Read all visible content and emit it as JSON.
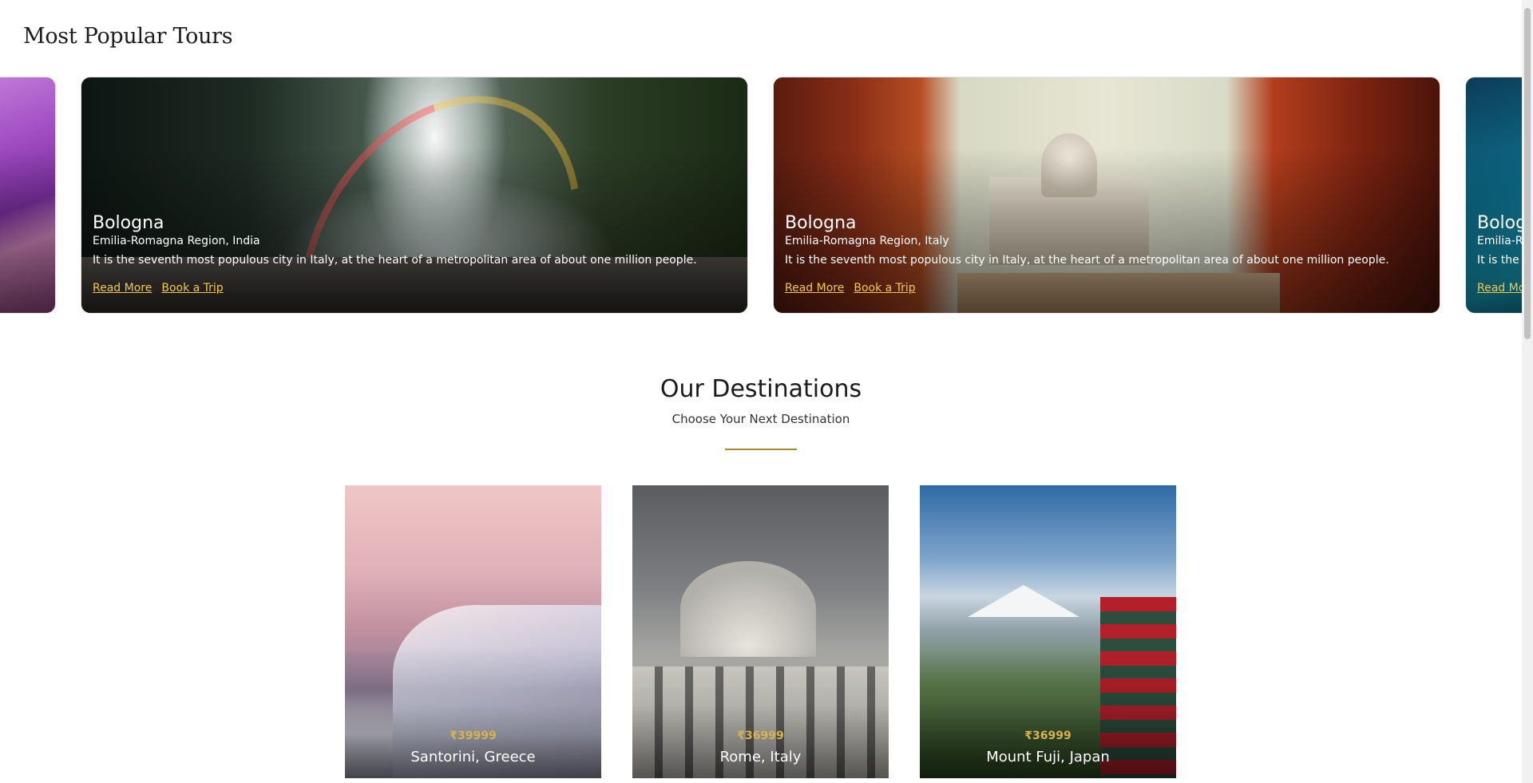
{
  "popular": {
    "title": "Most Popular Tours",
    "cards": [
      {
        "title": "",
        "region": "",
        "desc": "",
        "read_more": "",
        "book": ""
      },
      {
        "title": "Bologna",
        "region": "Emilia-Romagna Region, India",
        "desc": "It is the seventh most populous city in Italy, at the heart of a metropolitan area of about one million people.",
        "read_more": "Read More",
        "book": "Book a Trip"
      },
      {
        "title": "Bologna",
        "region": "Emilia-Romagna Region, Italy",
        "desc": "It is the seventh most populous city in Italy, at the heart of a metropolitan area of about one million people.",
        "read_more": "Read More",
        "book": "Book a Trip"
      },
      {
        "title": "Bolog",
        "region": "Emilia-R",
        "desc": "It is the",
        "read_more": "Read Mo",
        "book": ""
      }
    ]
  },
  "destinations": {
    "title": "Our Destinations",
    "subtitle": "Choose Your Next Destination",
    "items": [
      {
        "price": "₹39999",
        "name": "Santorini, Greece"
      },
      {
        "price": "₹36999",
        "name": "Rome, Italy"
      },
      {
        "price": "₹36999",
        "name": "Mount Fuji, Japan"
      }
    ]
  },
  "colors": {
    "accent": "#a78a2a",
    "link": "#f2c84b",
    "price": "#d6b254"
  }
}
